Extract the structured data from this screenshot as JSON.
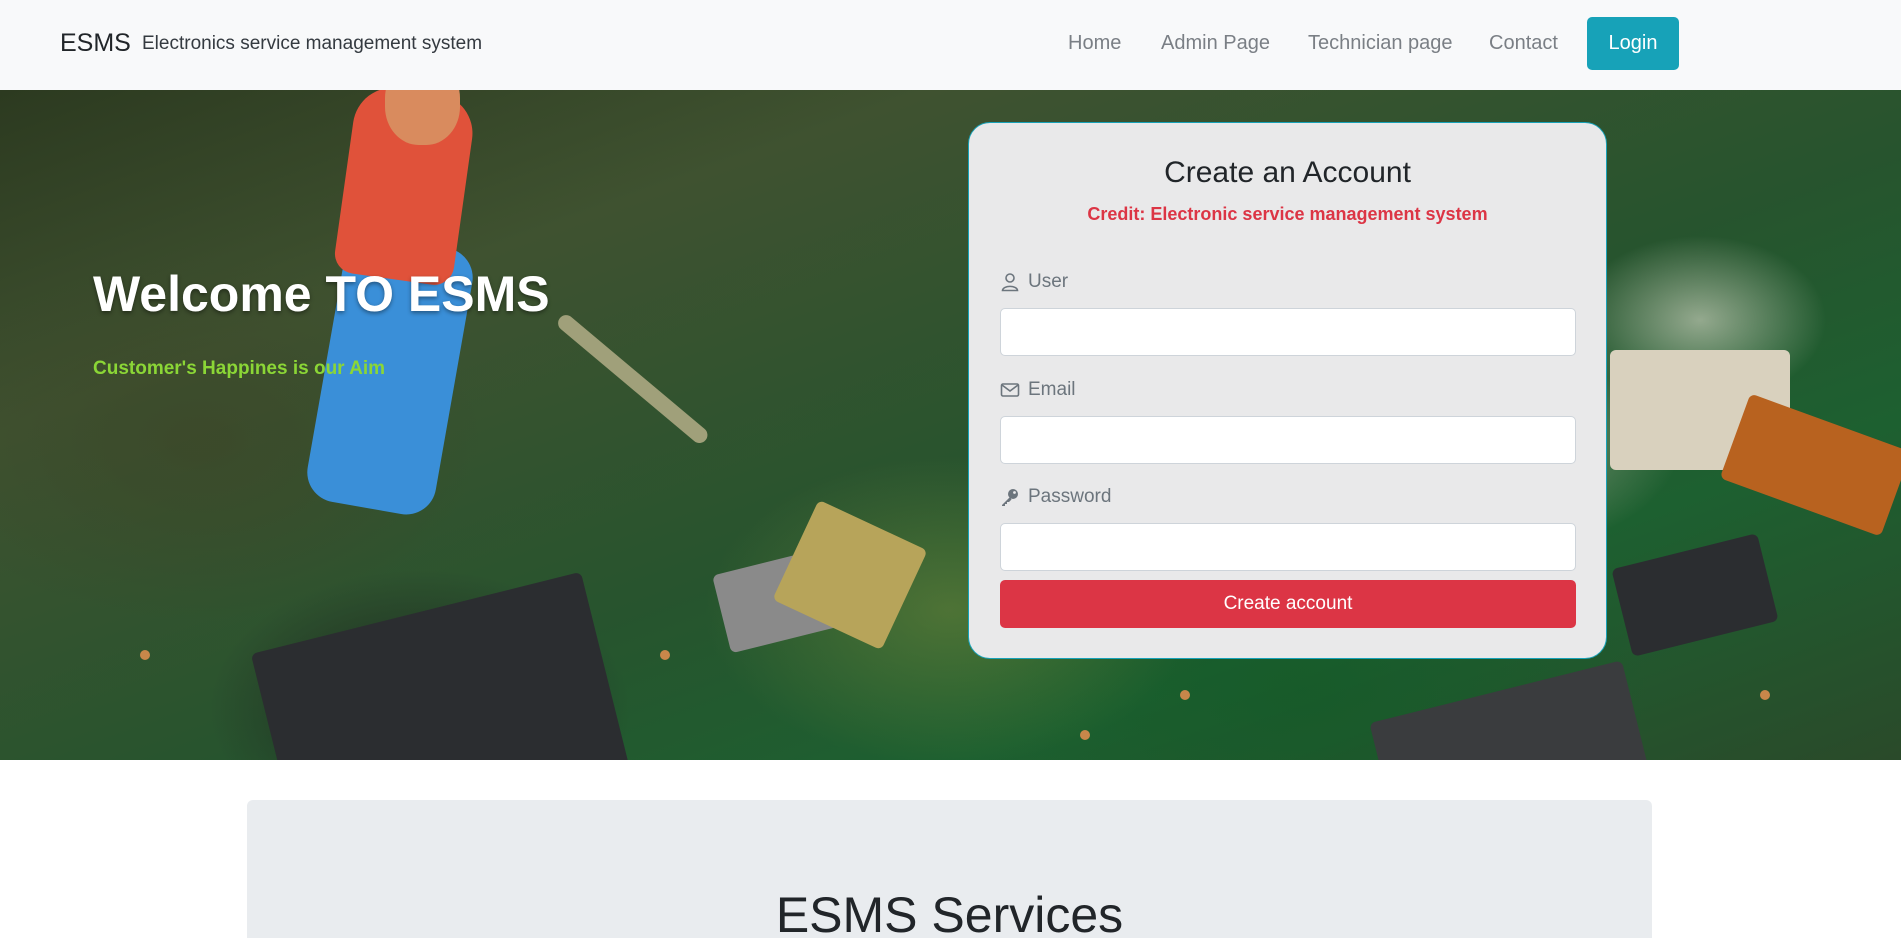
{
  "navbar": {
    "brand": "ESMS",
    "subtitle": "Electronics service management system",
    "links": [
      "Home",
      "Admin Page",
      "Technician page",
      "Contact"
    ],
    "login_label": "Login",
    "login_color": "#17a2b8"
  },
  "hero": {
    "title": "Welcome TO ESMS",
    "tagline": "Customer's Happines is our Aim",
    "tagline_color": "#8bd636"
  },
  "form": {
    "title": "Create an Account",
    "credit": "Credit: Electronic service management system",
    "fields": [
      {
        "label": "User",
        "icon": "user-icon",
        "value": "",
        "placeholder": ""
      },
      {
        "label": "Email",
        "icon": "envelope-icon",
        "value": "",
        "placeholder": ""
      },
      {
        "label": "Password",
        "icon": "key-icon",
        "value": "",
        "placeholder": ""
      }
    ],
    "submit_label": "Create account",
    "submit_color": "#dc3545"
  },
  "services": {
    "title": "ESMS Services"
  }
}
